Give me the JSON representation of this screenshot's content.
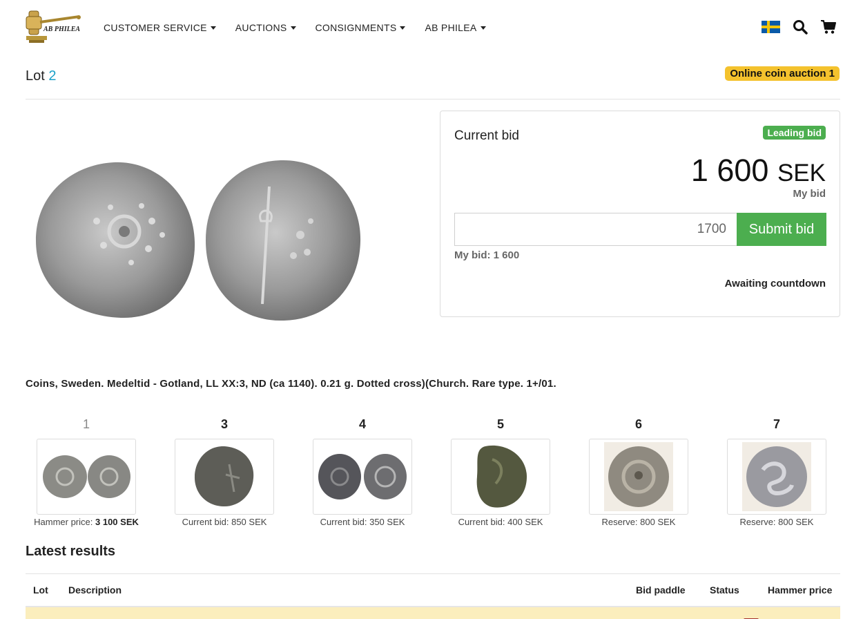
{
  "header": {
    "logo_text": "AB PHILEA",
    "nav": [
      {
        "label": "CUSTOMER SERVICE"
      },
      {
        "label": "AUCTIONS"
      },
      {
        "label": "CONSIGNMENTS"
      },
      {
        "label": "AB PHILEA"
      }
    ],
    "icons": [
      "swedish-flag-icon",
      "search-icon",
      "cart-icon"
    ]
  },
  "lot": {
    "label": "Lot",
    "number": "2",
    "auction_badge": "Online coin auction 1"
  },
  "bid_panel": {
    "title": "Current bid",
    "status_badge": "Leading bid",
    "amount": "1 600",
    "currency": "SEK",
    "my_bid_caption": "My bid",
    "input_value": "1700",
    "submit_label": "Submit bid",
    "my_bid_text": "My bid: 1 600",
    "countdown": "Awaiting countdown"
  },
  "description": "Coins, Sweden. Medeltid - Gotland, LL XX:3, ND (ca 1140). 0.21 g. Dotted cross)(Church. Rare type. 1+/01.",
  "other_lots": [
    {
      "number": "1",
      "price_label": "Hammer price:",
      "price_value": "3 100 SEK"
    },
    {
      "number": "3",
      "price_label": "Current bid: 850 SEK",
      "price_value": ""
    },
    {
      "number": "4",
      "price_label": "Current bid: 350 SEK",
      "price_value": ""
    },
    {
      "number": "5",
      "price_label": "Current bid: 400 SEK",
      "price_value": ""
    },
    {
      "number": "6",
      "price_label": "Reserve: 800 SEK",
      "price_value": ""
    },
    {
      "number": "7",
      "price_label": "Reserve: 800 SEK",
      "price_value": ""
    }
  ],
  "latest_results": {
    "title": "Latest results",
    "columns": [
      "Lot",
      "Description",
      "Bid paddle",
      "Status",
      "Hammer price"
    ]
  },
  "colors": {
    "accent": "#1aa0c8",
    "green": "#4cae4f",
    "badge_yellow": "#f4c22d",
    "row_highlight": "#fbeebd"
  }
}
